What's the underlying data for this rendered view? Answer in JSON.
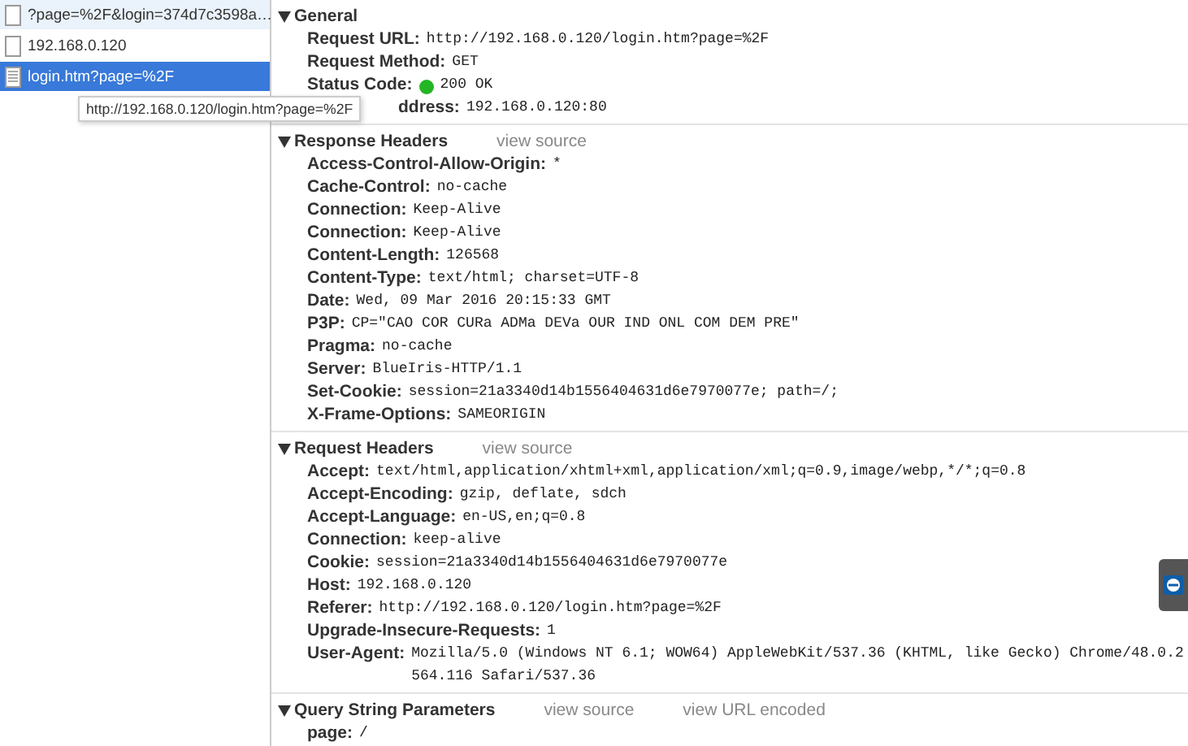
{
  "request_list": [
    {
      "name": "?page=%2F&login=374d7c3598a…",
      "kind": "blank",
      "selected": false
    },
    {
      "name": "192.168.0.120",
      "kind": "blank",
      "selected": false
    },
    {
      "name": "login.htm?page=%2F",
      "kind": "document",
      "selected": true
    }
  ],
  "tooltip": "http://192.168.0.120/login.htm?page=%2F",
  "sections": [
    {
      "title": "General",
      "expanded": true,
      "rows": [
        {
          "kind": "plain",
          "name": "Request URL:",
          "value": "http://192.168.0.120/login.htm?page=%2F"
        },
        {
          "kind": "plain",
          "name": "Request Method:",
          "value": "GET"
        },
        {
          "kind": "status",
          "name": "Status Code:",
          "value": "200 OK"
        },
        {
          "kind": "covered",
          "name": "ddress:",
          "value": "192.168.0.120:80"
        }
      ]
    },
    {
      "title": "Response Headers",
      "expanded": true,
      "links": [
        "view source"
      ],
      "rows": [
        {
          "kind": "plain",
          "name": "Access-Control-Allow-Origin:",
          "value": "*"
        },
        {
          "kind": "plain",
          "name": "Cache-Control:",
          "value": "no-cache"
        },
        {
          "kind": "plain",
          "name": "Connection:",
          "value": "Keep-Alive"
        },
        {
          "kind": "plain",
          "name": "Connection:",
          "value": "Keep-Alive"
        },
        {
          "kind": "plain",
          "name": "Content-Length:",
          "value": "126568"
        },
        {
          "kind": "plain",
          "name": "Content-Type:",
          "value": "text/html; charset=UTF-8"
        },
        {
          "kind": "plain",
          "name": "Date:",
          "value": "Wed, 09 Mar 2016 20:15:33 GMT"
        },
        {
          "kind": "plain",
          "name": "P3P:",
          "value": "CP=\"CAO COR CURa ADMa DEVa OUR IND ONL COM DEM PRE\""
        },
        {
          "kind": "plain",
          "name": "Pragma:",
          "value": "no-cache"
        },
        {
          "kind": "plain",
          "name": "Server:",
          "value": "BlueIris-HTTP/1.1"
        },
        {
          "kind": "plain",
          "name": "Set-Cookie:",
          "value": "session=21a3340d14b1556404631d6e7970077e; path=/;"
        },
        {
          "kind": "plain",
          "name": "X-Frame-Options:",
          "value": "SAMEORIGIN"
        }
      ]
    },
    {
      "title": "Request Headers",
      "expanded": true,
      "links": [
        "view source"
      ],
      "rows": [
        {
          "kind": "plain",
          "name": "Accept:",
          "value": "text/html,application/xhtml+xml,application/xml;q=0.9,image/webp,*/*;q=0.8"
        },
        {
          "kind": "plain",
          "name": "Accept-Encoding:",
          "value": "gzip, deflate, sdch"
        },
        {
          "kind": "plain",
          "name": "Accept-Language:",
          "value": "en-US,en;q=0.8"
        },
        {
          "kind": "plain",
          "name": "Connection:",
          "value": "keep-alive"
        },
        {
          "kind": "plain",
          "name": "Cookie:",
          "value": "session=21a3340d14b1556404631d6e7970077e"
        },
        {
          "kind": "plain",
          "name": "Host:",
          "value": "192.168.0.120"
        },
        {
          "kind": "plain",
          "name": "Referer:",
          "value": "http://192.168.0.120/login.htm?page=%2F"
        },
        {
          "kind": "plain",
          "name": "Upgrade-Insecure-Requests:",
          "value": "1"
        },
        {
          "kind": "plain",
          "name": "User-Agent:",
          "value": "Mozilla/5.0 (Windows NT 6.1; WOW64) AppleWebKit/537.36 (KHTML, like Gecko) Chrome/48.0.2564.116 Safari/537.36"
        }
      ]
    },
    {
      "title": "Query String Parameters",
      "expanded": true,
      "links": [
        "view source",
        "view URL encoded"
      ],
      "rows": [
        {
          "kind": "plain",
          "name": "page:",
          "value": "/"
        }
      ]
    }
  ]
}
